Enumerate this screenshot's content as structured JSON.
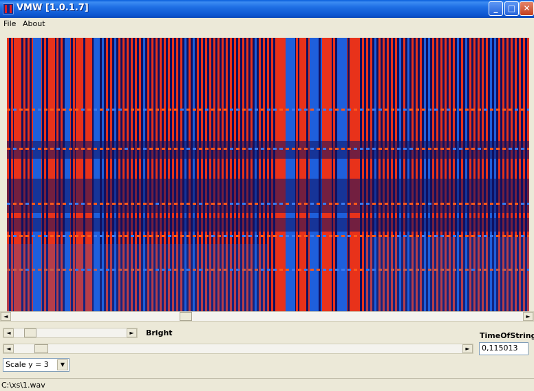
{
  "window": {
    "title": "VMW [1.0.1.7]",
    "controls": {
      "minimize": "_",
      "maximize": "□",
      "close": "✕"
    }
  },
  "menu": {
    "items": [
      {
        "label": "File"
      },
      {
        "label": "About"
      }
    ]
  },
  "view": {
    "image": "spectrogram"
  },
  "controls": {
    "bright_label": "Bright",
    "time_label": "TimeOfString",
    "time_value": "0,115013",
    "scale_selected": "Scale y = 3"
  },
  "icons": {
    "left": "◄",
    "right": "►",
    "down": "▼"
  },
  "status": {
    "file_path": "C:\\xs\\1.wav"
  },
  "colors": {
    "red": "#e8321a",
    "blue": "#1e5fdc",
    "dark": "#101060",
    "title": "#0b55d0"
  }
}
